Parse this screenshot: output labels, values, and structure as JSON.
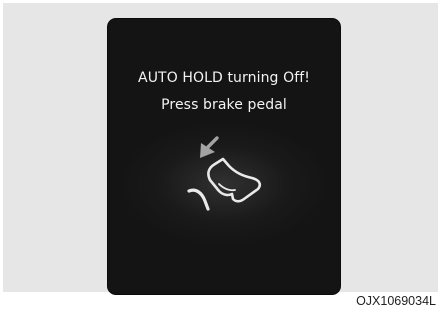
{
  "display": {
    "message_line1": "AUTO HOLD turning Off!",
    "message_line2": "Press brake pedal",
    "icon": "brake-pedal-press-icon",
    "text_color": "#f3f3f3",
    "background_color": "#141414"
  },
  "figure_code": "OJX1069034L"
}
